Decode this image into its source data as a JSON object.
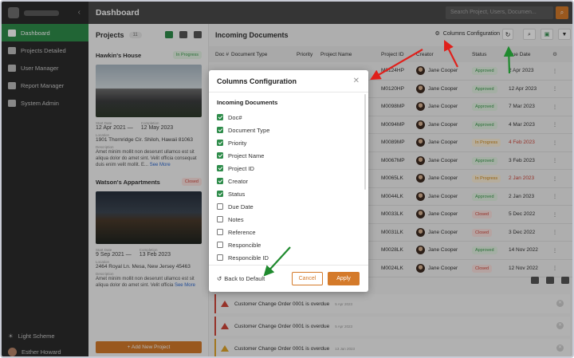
{
  "topbar": {
    "title": "Dashboard",
    "search_placeholder": "Search Project, Users, Documen..."
  },
  "sidebar": {
    "items": [
      {
        "label": "Dashboard",
        "icon": "home-icon",
        "active": true
      },
      {
        "label": "Projects Detailed",
        "icon": "briefcase-icon"
      },
      {
        "label": "User Manager",
        "icon": "users-icon"
      },
      {
        "label": "Report Manager",
        "icon": "report-icon"
      },
      {
        "label": "System Admin",
        "icon": "monitor-icon"
      }
    ],
    "bottom": {
      "scheme_label": "Light Scheme",
      "user_name": "Esther Howard"
    }
  },
  "projects": {
    "title": "Projects",
    "count": "11",
    "cards": [
      {
        "name": "Hawkin's House",
        "status": "In Progress",
        "start_label": "Start Date",
        "start": "12 Apr 2021",
        "sep": "—",
        "completion_label": "Completion",
        "completion": "12 May 2023",
        "location_label": "Location",
        "location": "1901 Thornridge Cir. Shiloh, Hawaii 81063",
        "description_label": "Description",
        "description": "Amet minim mollit non deserunt ullamco est sit aliqua dolor do amet sint. Velit officia consequat duis enim velit mollit. E...",
        "see_more": "See More"
      },
      {
        "name": "Watson's Appartments",
        "status": "Closed",
        "start_label": "Start Date",
        "start": "9 Sep 2021",
        "sep": "—",
        "completion_label": "Completion",
        "completion": "13 Feb 2023",
        "location_label": "Location",
        "location": "2464 Royal Ln. Mesa, New Jersey 45463",
        "description_label": "Description",
        "description": "Amet minim mollit non deserunt ullamco est sit aliqua dolor do amet sint. Velit officia",
        "see_more": "See More"
      }
    ],
    "add_button": "+ Add New Project"
  },
  "main": {
    "title": "Incoming Documents",
    "columns_config_label": "Columns Configuration",
    "headers": [
      "Doc #",
      "Document Type",
      "Priority",
      "Project Name",
      "Project ID",
      "Creator",
      "Status",
      "Due Date"
    ],
    "rows": [
      {
        "pid": "M0124HP",
        "creator": "Jane Cooper",
        "status": "Approved",
        "due": "2 Apr 2023",
        "status_type": "approved"
      },
      {
        "pid": "M0120HP",
        "creator": "Jane Cooper",
        "status": "Approved",
        "due": "12 Apr 2023",
        "status_type": "approved"
      },
      {
        "pid": "M0098MP",
        "creator": "Jane Cooper",
        "status": "Approved",
        "due": "7 Mar 2023",
        "status_type": "approved"
      },
      {
        "pid": "M0094MP",
        "creator": "Jane Cooper",
        "status": "Approved",
        "due": "4 Mar 2023",
        "status_type": "approved"
      },
      {
        "pid": "M0089MP",
        "creator": "Jane Cooper",
        "status": "In Progress",
        "due": "4 Feb 2023",
        "status_type": "inprogress",
        "due_red": true
      },
      {
        "pid": "M0067MP",
        "creator": "Jane Cooper",
        "status": "Approved",
        "due": "3 Feb 2023",
        "status_type": "approved"
      },
      {
        "pid": "M0065LK",
        "creator": "Jane Cooper",
        "status": "In Progress",
        "due": "2 Jan 2023",
        "status_type": "inprogress",
        "due_red": true
      },
      {
        "pid": "M0044LK",
        "creator": "Jane Cooper",
        "status": "Approved",
        "due": "2 Jan 2023",
        "status_type": "approved"
      },
      {
        "pid": "M0033LK",
        "creator": "Jane Cooper",
        "status": "Closed",
        "due": "5 Dec 2022",
        "status_type": "closed"
      },
      {
        "pid": "M0031LK",
        "creator": "Jane Cooper",
        "status": "Closed",
        "due": "3 Dec 2022",
        "status_type": "closed"
      },
      {
        "pid": "M0028LK",
        "creator": "Jane Cooper",
        "status": "Approved",
        "due": "14 Nov 2022",
        "status_type": "approved"
      },
      {
        "pid": "M0024LK",
        "creator": "Jane Cooper",
        "status": "Closed",
        "due": "12 Nov 2022",
        "status_type": "closed"
      }
    ],
    "alerts": [
      {
        "text": "Customer Change Order 0001 is overdue",
        "date": "5 Apr 2023",
        "level": "error"
      },
      {
        "text": "Customer Change Order 0001 is overdue",
        "date": "5 Apr 2023",
        "level": "error"
      },
      {
        "text": "Customer Change Order 0001 is overdue",
        "date": "13 Jan 2023",
        "level": "warn"
      }
    ]
  },
  "modal": {
    "title": "Columns Configuration",
    "section": "Incoming Documents",
    "options": [
      {
        "label": "Doc#",
        "checked": true
      },
      {
        "label": "Document Type",
        "checked": true
      },
      {
        "label": "Priority",
        "checked": true
      },
      {
        "label": "Project Name",
        "checked": true
      },
      {
        "label": "Project ID",
        "checked": true
      },
      {
        "label": "Creator",
        "checked": true
      },
      {
        "label": "Status",
        "checked": true
      },
      {
        "label": "Due Date",
        "checked": false
      },
      {
        "label": "Notes",
        "checked": false
      },
      {
        "label": "Reference",
        "checked": false
      },
      {
        "label": "Responcible",
        "checked": false
      },
      {
        "label": "Responcible ID",
        "checked": false
      }
    ],
    "back_to_default": "Back to Default",
    "cancel": "Cancel",
    "apply": "Apply"
  },
  "colors": {
    "accent": "#d47a2a",
    "active_green": "#2e8c4a",
    "arrow_red": "#e0201b",
    "arrow_green": "#1f8a2e"
  }
}
